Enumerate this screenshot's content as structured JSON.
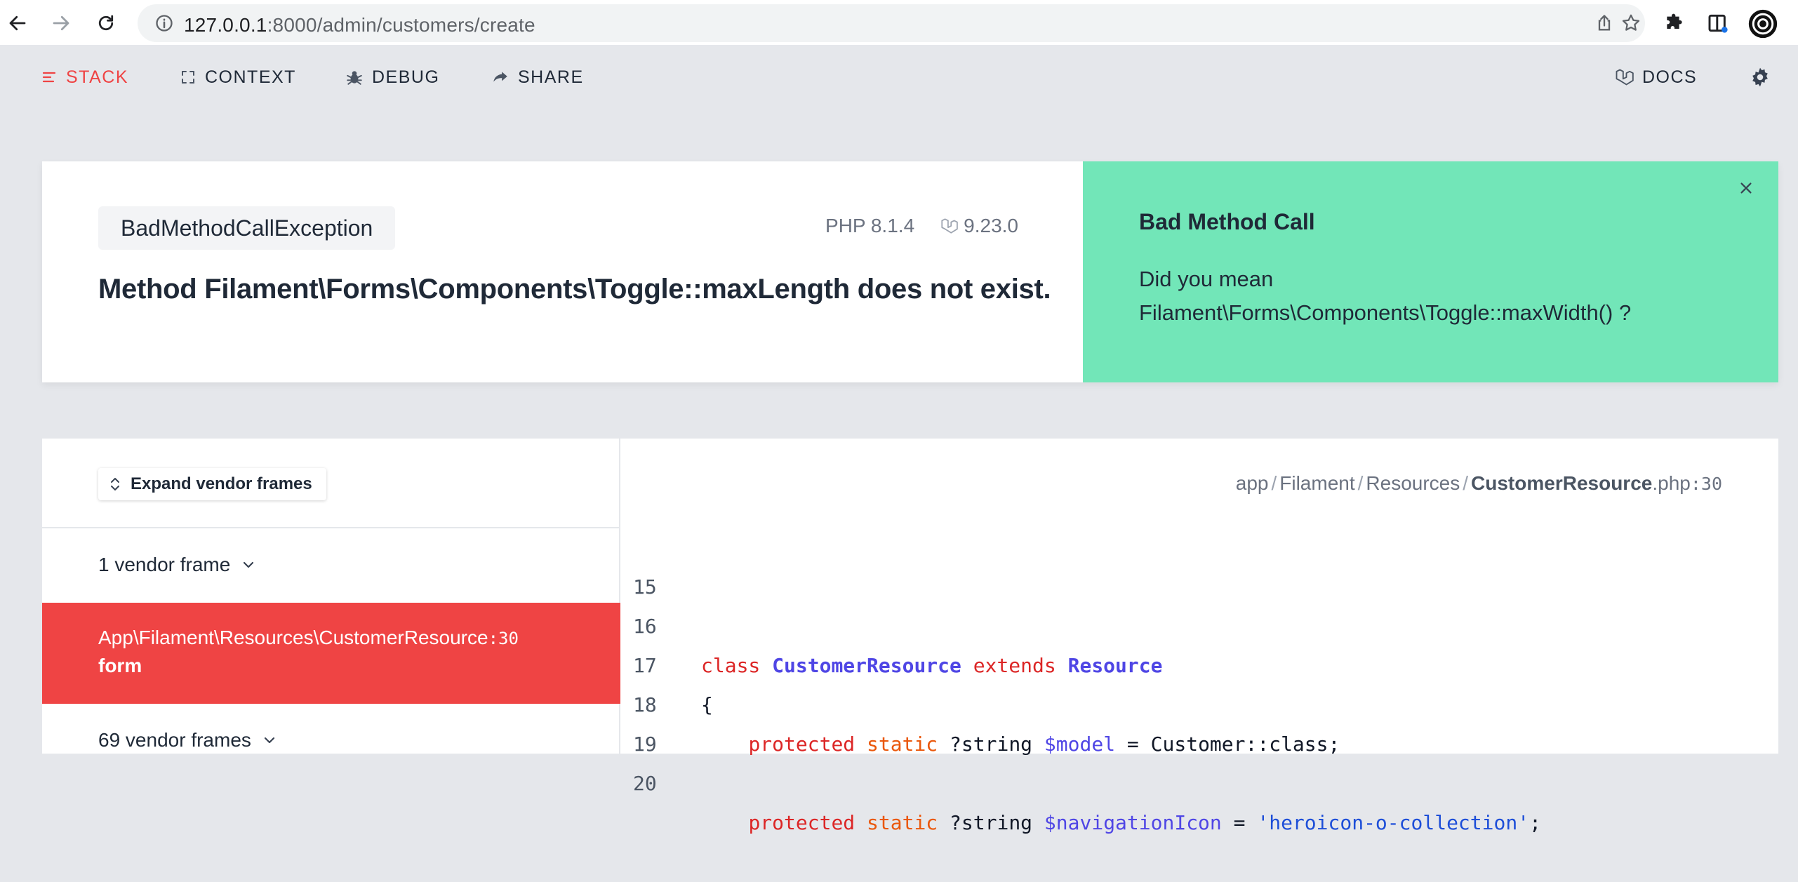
{
  "browser": {
    "url_host": "127.0.0.1",
    "url_rest": ":8000/admin/customers/create"
  },
  "topnav": {
    "stack": "STACK",
    "context": "CONTEXT",
    "debug": "DEBUG",
    "share": "SHARE",
    "docs": "DOCS"
  },
  "error": {
    "exception_class": "BadMethodCallException",
    "message": "Method Filament\\Forms\\Components\\Toggle::maxLength does not exist.",
    "php_version": "PHP 8.1.4",
    "laravel_version": "9.23.0"
  },
  "solution": {
    "title": "Bad Method Call",
    "text_line1": "Did you mean",
    "text_line2": "Filament\\Forms\\Components\\Toggle::maxWidth() ?"
  },
  "frames": {
    "expand_label": "Expand vendor frames",
    "vendor_group_1": "1 vendor frame",
    "active_class": "App\\Filament\\Resources\\CustomerResource",
    "active_line": ":30",
    "active_method": "form",
    "vendor_group_2": "69 vendor frames"
  },
  "code": {
    "path_1": "app",
    "path_2": "Filament",
    "path_3": "Resources",
    "file_name": "CustomerResource",
    "file_ext": ".php",
    "file_line": ":30",
    "lines": [
      {
        "num": "15"
      },
      {
        "num": "16",
        "t1": "class",
        "t2": "CustomerResource",
        "t3": "extends",
        "t4": "Resource"
      },
      {
        "num": "17",
        "t1": "{"
      },
      {
        "num": "18",
        "t1": "protected",
        "t2": "static",
        "t3": "?string",
        "t4": "$model",
        "t5": "= Customer::class;"
      },
      {
        "num": "19"
      },
      {
        "num": "20",
        "t1": "protected",
        "t2": "static",
        "t3": "?string",
        "t4": "$navigationIcon",
        "t5": "=",
        "t6": "'heroicon-o-collection'",
        "t7": ";"
      }
    ]
  }
}
